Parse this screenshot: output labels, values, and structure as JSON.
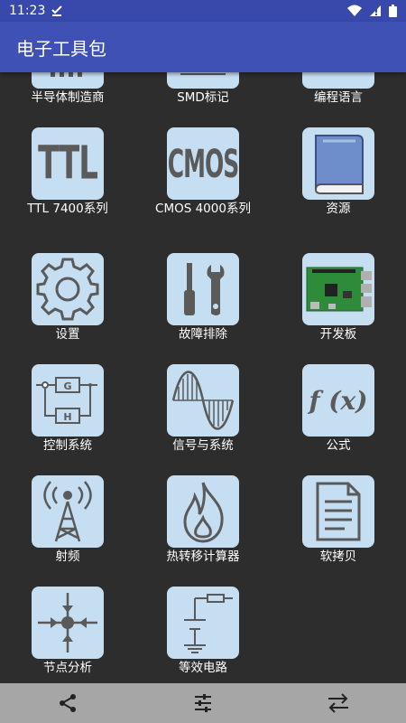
{
  "status": {
    "time": "11:23"
  },
  "app": {
    "title": "电子工具包"
  },
  "tools": [
    {
      "label": "半导体制造商"
    },
    {
      "label": "SMD标记"
    },
    {
      "label": "编程语言"
    },
    {
      "label": "TTL 7400系列",
      "icon_text": "TTL"
    },
    {
      "label": "CMOS 4000系列",
      "icon_text": "CMOS"
    },
    {
      "label": "资源"
    },
    {
      "label": "设置"
    },
    {
      "label": "故障排除"
    },
    {
      "label": "开发板"
    },
    {
      "label": "控制系统",
      "g": "G",
      "h": "H"
    },
    {
      "label": "信号与系统"
    },
    {
      "label": "公式",
      "formula": "f (x)"
    },
    {
      "label": "射频"
    },
    {
      "label": "热转移计算器"
    },
    {
      "label": "软拷贝"
    },
    {
      "label": "节点分析"
    },
    {
      "label": "等效电路"
    }
  ],
  "icons": {
    "share": "share-icon",
    "settings": "sliders-icon",
    "switch": "swap-icon"
  },
  "colors": {
    "status_bar": "#3949ab",
    "app_bar": "#3f51b5",
    "background": "#2d2d2d",
    "tile": "#c6def2",
    "icon": "#5a5a5a",
    "bottom_nav": "#a6a6a6"
  }
}
